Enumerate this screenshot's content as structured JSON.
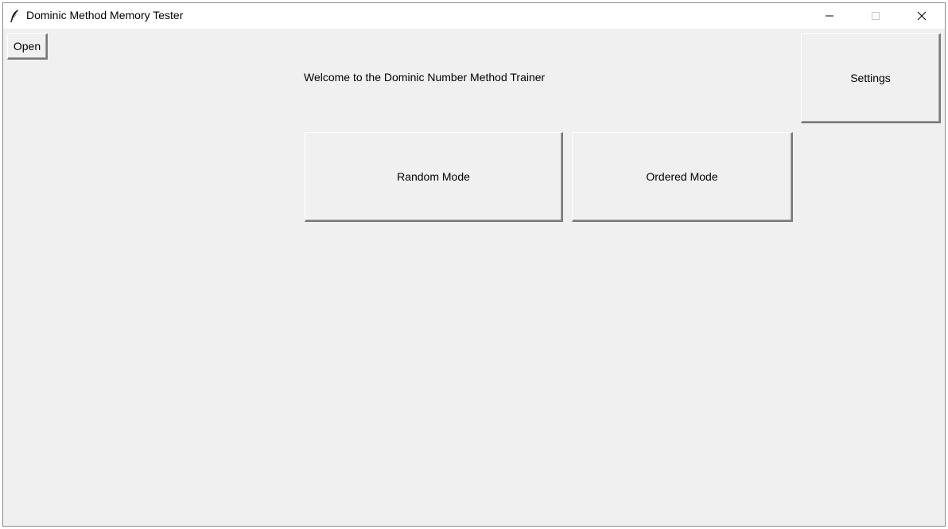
{
  "window": {
    "title": "Dominic Method Memory Tester"
  },
  "titlebar_controls": {
    "minimize_icon": "minimize-icon",
    "maximize_icon": "maximize-icon",
    "close_icon": "close-icon"
  },
  "toolbar": {
    "open_label": "Open"
  },
  "main": {
    "welcome_text": "Welcome to the Dominic Number Method Trainer",
    "settings_label": "Settings",
    "random_mode_label": "Random Mode",
    "ordered_mode_label": "Ordered Mode"
  },
  "colors": {
    "window_bg": "#f0f0f0",
    "titlebar_bg": "#ffffff"
  }
}
